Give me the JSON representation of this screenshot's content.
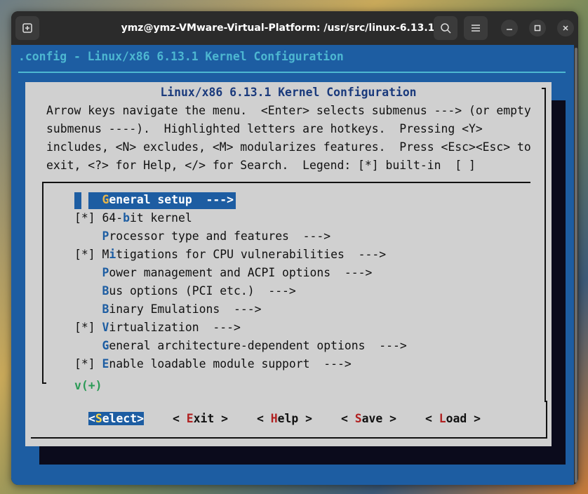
{
  "window": {
    "title": "ymz@ymz-VMware-Virtual-Platform: /usr/src/linux-6.13.1"
  },
  "terminal": {
    "config_title": ".config - Linux/x86 6.13.1 Kernel Configuration",
    "dialog_title": "Linux/x86 6.13.1 Kernel Configuration",
    "help_lines": [
      "Arrow keys navigate the menu.  <Enter> selects submenus ---> (or empty",
      "submenus ----).  Highlighted letters are hotkeys.  Pressing <Y>",
      "includes, <N> excludes, <M> modularizes features.  Press <Esc><Esc> to",
      "exit, <?> for Help, </> for Search.  Legend: [*] built-in  [ ]"
    ],
    "menu_items": [
      {
        "prefix": "    ",
        "hotkey": "G",
        "rest": "eneral setup  --->"
      },
      {
        "prefix": "[*] ",
        "hotkey": "",
        "pre_hot": "64-",
        "hotkey2": "b",
        "rest": "it kernel"
      },
      {
        "prefix": "    ",
        "hotkey": "P",
        "rest": "rocessor type and features  --->"
      },
      {
        "prefix": "[*] ",
        "hotkey": "",
        "pre_hot": "M",
        "hotkey2": "i",
        "rest": "tigations for CPU vulnerabilities  --->"
      },
      {
        "prefix": "    ",
        "hotkey": "P",
        "rest": "ower management and ACPI options  --->"
      },
      {
        "prefix": "    ",
        "hotkey": "B",
        "rest": "us options (PCI etc.)  --->"
      },
      {
        "prefix": "    ",
        "hotkey": "B",
        "rest": "inary Emulations  --->"
      },
      {
        "prefix": "[*] ",
        "hotkey": "V",
        "rest": "irtualization  --->"
      },
      {
        "prefix": "    ",
        "hotkey": "G",
        "rest": "eneral architecture-dependent options  --->"
      },
      {
        "prefix": "[*] ",
        "hotkey": "E",
        "rest": "nable loadable module support  --->"
      }
    ],
    "more_indicator": "v(+)",
    "buttons": [
      {
        "open": "<",
        "hotkey": "S",
        "rest": "elect",
        "close": ">"
      },
      {
        "open": "< ",
        "hotkey": "E",
        "rest": "xit",
        "close": " >"
      },
      {
        "open": "< ",
        "hotkey": "H",
        "rest": "elp",
        "close": " >"
      },
      {
        "open": "< ",
        "hotkey": "S",
        "rest": "ave",
        "close": " >"
      },
      {
        "open": "< ",
        "hotkey": "L",
        "rest": "oad",
        "close": " >"
      }
    ]
  },
  "colors": {
    "terminal_bg": "#1d5da2",
    "dialog_bg": "#d0d0d0",
    "title_accent": "#4db7d1",
    "hotkey_button": "#b02020",
    "more_indicator": "#2a9a55"
  },
  "icons": {
    "new_tab": "new-tab-icon",
    "search": "search-icon",
    "menu": "hamburger-menu-icon",
    "minimize": "minimize-icon",
    "maximize": "maximize-icon",
    "close": "close-icon"
  }
}
